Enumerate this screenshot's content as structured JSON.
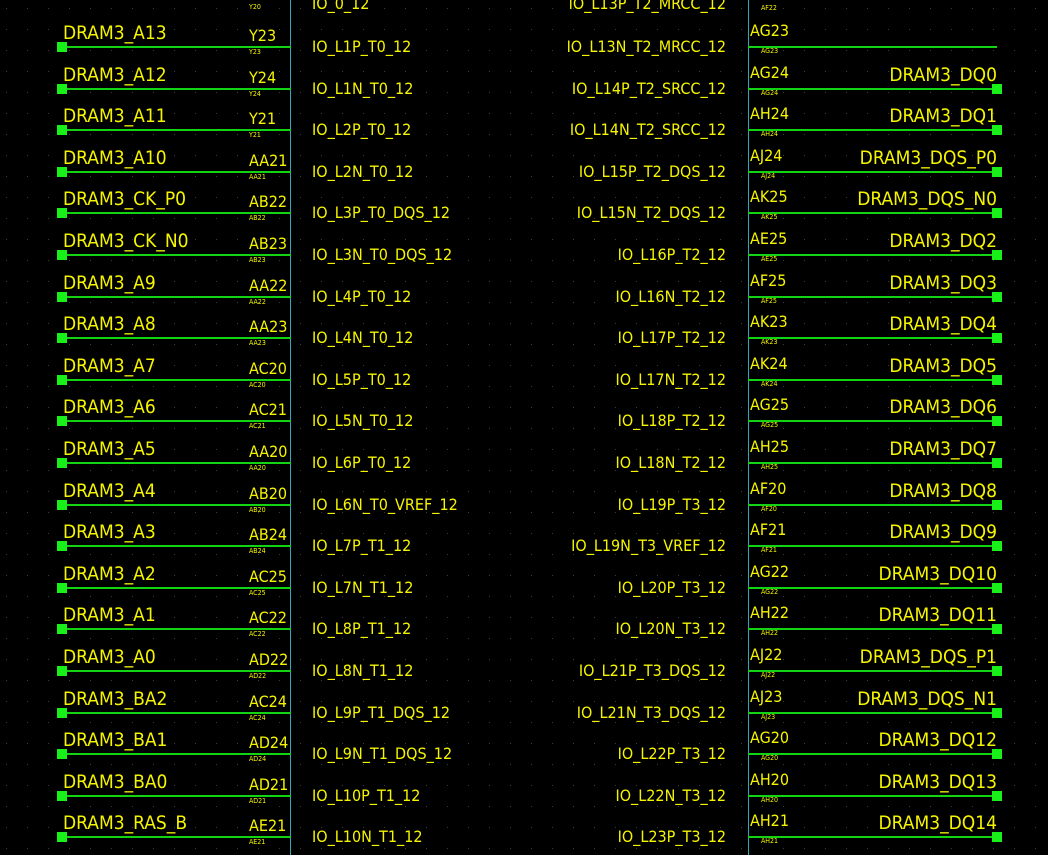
{
  "colors": {
    "background": "#000000",
    "text": "#f5f500",
    "wire": "#12d412",
    "terminal": "#19f019",
    "component_body": "#37a5b8",
    "grid_dot": "#3c3c3c"
  },
  "top_partial": {
    "left_pin_small": "Y20",
    "left_io": "IO_0_12",
    "right_io": "IO_L13P_T2_MRCC_12",
    "right_pin_small": "AF22"
  },
  "left_pins": [
    {
      "net": "DRAM3_A13",
      "pin": "Y23",
      "io": "IO_L1P_T0_12"
    },
    {
      "net": "DRAM3_A12",
      "pin": "Y24",
      "io": "IO_L1N_T0_12"
    },
    {
      "net": "DRAM3_A11",
      "pin": "Y21",
      "io": "IO_L2P_T0_12"
    },
    {
      "net": "DRAM3_A10",
      "pin": "AA21",
      "io": "IO_L2N_T0_12"
    },
    {
      "net": "DRAM3_CK_P0",
      "pin": "AB22",
      "io": "IO_L3P_T0_DQS_12"
    },
    {
      "net": "DRAM3_CK_N0",
      "pin": "AB23",
      "io": "IO_L3N_T0_DQS_12"
    },
    {
      "net": "DRAM3_A9",
      "pin": "AA22",
      "io": "IO_L4P_T0_12"
    },
    {
      "net": "DRAM3_A8",
      "pin": "AA23",
      "io": "IO_L4N_T0_12"
    },
    {
      "net": "DRAM3_A7",
      "pin": "AC20",
      "io": "IO_L5P_T0_12"
    },
    {
      "net": "DRAM3_A6",
      "pin": "AC21",
      "io": "IO_L5N_T0_12"
    },
    {
      "net": "DRAM3_A5",
      "pin": "AA20",
      "io": "IO_L6P_T0_12"
    },
    {
      "net": "DRAM3_A4",
      "pin": "AB20",
      "io": "IO_L6N_T0_VREF_12"
    },
    {
      "net": "DRAM3_A3",
      "pin": "AB24",
      "io": "IO_L7P_T1_12"
    },
    {
      "net": "DRAM3_A2",
      "pin": "AC25",
      "io": "IO_L7N_T1_12"
    },
    {
      "net": "DRAM3_A1",
      "pin": "AC22",
      "io": "IO_L8P_T1_12"
    },
    {
      "net": "DRAM3_A0",
      "pin": "AD22",
      "io": "IO_L8N_T1_12"
    },
    {
      "net": "DRAM3_BA2",
      "pin": "AC24",
      "io": "IO_L9P_T1_DQS_12"
    },
    {
      "net": "DRAM3_BA1",
      "pin": "AD24",
      "io": "IO_L9N_T1_DQS_12"
    },
    {
      "net": "DRAM3_BA0",
      "pin": "AD21",
      "io": "IO_L10P_T1_12"
    },
    {
      "net": "DRAM3_RAS_B",
      "pin": "AE21",
      "io": "IO_L10N_T1_12"
    }
  ],
  "right_pins": [
    {
      "net": "",
      "pin": "AG23",
      "io": "IO_L13N_T2_MRCC_12"
    },
    {
      "net": "DRAM3_DQ0",
      "pin": "AG24",
      "io": "IO_L14P_T2_SRCC_12"
    },
    {
      "net": "DRAM3_DQ1",
      "pin": "AH24",
      "io": "IO_L14N_T2_SRCC_12"
    },
    {
      "net": "DRAM3_DQS_P0",
      "pin": "AJ24",
      "io": "IO_L15P_T2_DQS_12"
    },
    {
      "net": "DRAM3_DQS_N0",
      "pin": "AK25",
      "io": "IO_L15N_T2_DQS_12"
    },
    {
      "net": "DRAM3_DQ2",
      "pin": "AE25",
      "io": "IO_L16P_T2_12"
    },
    {
      "net": "DRAM3_DQ3",
      "pin": "AF25",
      "io": "IO_L16N_T2_12"
    },
    {
      "net": "DRAM3_DQ4",
      "pin": "AK23",
      "io": "IO_L17P_T2_12"
    },
    {
      "net": "DRAM3_DQ5",
      "pin": "AK24",
      "io": "IO_L17N_T2_12"
    },
    {
      "net": "DRAM3_DQ6",
      "pin": "AG25",
      "io": "IO_L18P_T2_12"
    },
    {
      "net": "DRAM3_DQ7",
      "pin": "AH25",
      "io": "IO_L18N_T2_12"
    },
    {
      "net": "DRAM3_DQ8",
      "pin": "AF20",
      "io": "IO_L19P_T3_12"
    },
    {
      "net": "DRAM3_DQ9",
      "pin": "AF21",
      "io": "IO_L19N_T3_VREF_12"
    },
    {
      "net": "DRAM3_DQ10",
      "pin": "AG22",
      "io": "IO_L20P_T3_12"
    },
    {
      "net": "DRAM3_DQ11",
      "pin": "AH22",
      "io": "IO_L20N_T3_12"
    },
    {
      "net": "DRAM3_DQS_P1",
      "pin": "AJ22",
      "io": "IO_L21P_T3_DQS_12"
    },
    {
      "net": "DRAM3_DQS_N1",
      "pin": "AJ23",
      "io": "IO_L21N_T3_DQS_12"
    },
    {
      "net": "DRAM3_DQ12",
      "pin": "AG20",
      "io": "IO_L22P_T3_12"
    },
    {
      "net": "DRAM3_DQ13",
      "pin": "AH20",
      "io": "IO_L22N_T3_12"
    },
    {
      "net": "DRAM3_DQ14",
      "pin": "AH21",
      "io": "IO_L23P_T3_12"
    }
  ]
}
